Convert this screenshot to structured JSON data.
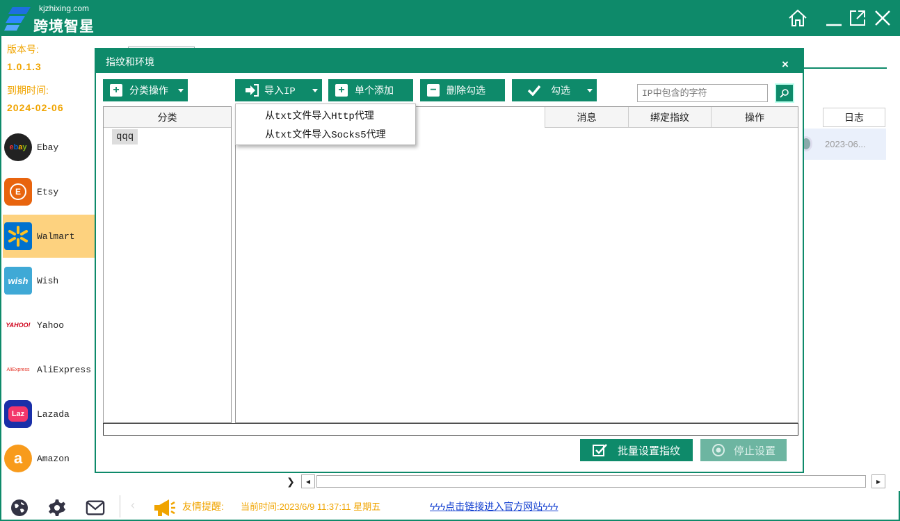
{
  "app": {
    "logo_url": "kjzhixing.com",
    "logo_name": "跨境智星"
  },
  "sidebar": {
    "version_label": "版本号:",
    "version_value": "1.0.1.3",
    "expiry_label": "到期时间:",
    "expiry_value": "2024-02-06",
    "items": [
      {
        "label": "Ebay",
        "icon": "ebay-icon"
      },
      {
        "label": "Etsy",
        "icon": "etsy-icon"
      },
      {
        "label": "Walmart",
        "icon": "walmart-icon",
        "active": true
      },
      {
        "label": "Wish",
        "icon": "wish-icon"
      },
      {
        "label": "Yahoo",
        "icon": "yahoo-icon"
      },
      {
        "label": "AliExpress",
        "icon": "aliexpress-icon"
      },
      {
        "label": "Lazada",
        "icon": "lazada-icon"
      },
      {
        "label": "Amazon",
        "icon": "amazon-icon"
      }
    ]
  },
  "background": {
    "col_log": "日志",
    "row_date": "2023-06..."
  },
  "modal": {
    "title": "指纹和环境",
    "close": "×",
    "toolbar": {
      "category_ops": "分类操作",
      "import_ip": "导入IP",
      "add_single": "单个添加",
      "delete_checked": "删除勾选",
      "check": "勾选"
    },
    "search_placeholder": "IP中包含的字符",
    "category_header": "分类",
    "categories": [
      "qqq"
    ],
    "columns": [
      "消息",
      "绑定指纹",
      "操作"
    ],
    "dropdown": [
      "从txt文件导入Http代理",
      "从txt文件导入Socks5代理"
    ],
    "batch_button": "批量设置指纹",
    "stop_button": "停止设置"
  },
  "footer": {
    "notice_label": "友情提醒:",
    "notice_time": "当前时间:2023/6/9  11:37:11 星期五",
    "link": "ϟϟϟ点击链接进入官方网站ϟϟϟ"
  },
  "colors": {
    "primary": "#0e8a6a",
    "accent": "#f0a400",
    "active_bg": "#fdd27f",
    "link": "#1340d0"
  }
}
